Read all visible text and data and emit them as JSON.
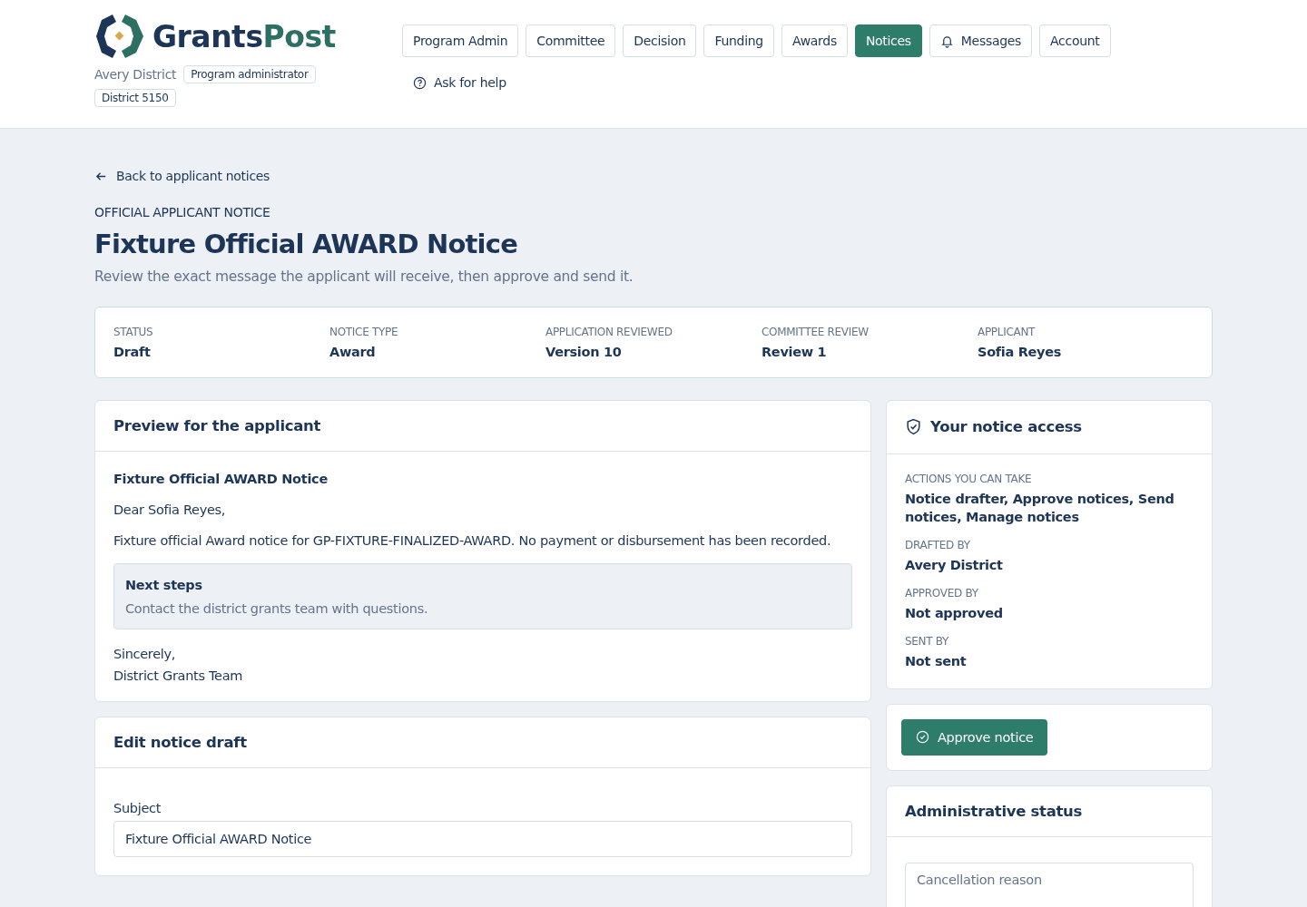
{
  "brand": {
    "first": "Grants",
    "second": "Post"
  },
  "user": {
    "name": "Avery District",
    "role": "Program administrator",
    "district": "District 5150"
  },
  "nav": [
    {
      "label": "Program Admin",
      "selected": false
    },
    {
      "label": "Committee",
      "selected": false
    },
    {
      "label": "Decision",
      "selected": false
    },
    {
      "label": "Funding",
      "selected": false
    },
    {
      "label": "Awards",
      "selected": false
    },
    {
      "label": "Notices",
      "selected": true
    },
    {
      "label": "Messages",
      "selected": false,
      "kind": "bell"
    },
    {
      "label": "Account",
      "selected": false
    }
  ],
  "help": "Ask for help",
  "back": "Back to applicant notices",
  "eyebrow": "OFFICIAL APPLICANT NOTICE",
  "title": "Fixture Official AWARD Notice",
  "subtitle": "Review the exact message the applicant will receive, then approve and send it.",
  "summary": [
    {
      "label": "STATUS",
      "value": "Draft"
    },
    {
      "label": "NOTICE TYPE",
      "value": "Award"
    },
    {
      "label": "APPLICATION REVIEWED",
      "value": "Version 10"
    },
    {
      "label": "COMMITTEE REVIEW",
      "value": "Review 1"
    },
    {
      "label": "APPLICANT",
      "value": "Sofia Reyes"
    }
  ],
  "preview": {
    "heading": "Preview for the applicant",
    "subject": "Fixture Official AWARD Notice",
    "greeting": "Dear Sofia Reyes,",
    "body": "Fixture official Award notice for GP-FIXTURE-FINALIZED-AWARD. No payment or disbursement has been recorded.",
    "next_title": "Next steps",
    "next_text": "Contact the district grants team with questions.",
    "closing": "Sincerely,",
    "signature": "District Grants Team"
  },
  "edit": {
    "heading": "Edit notice draft",
    "subject_label": "Subject",
    "subject_value": "Fixture Official AWARD Notice"
  },
  "access": {
    "heading": "Your notice access",
    "items": [
      {
        "label": "ACTIONS YOU CAN TAKE",
        "value": "Notice drafter, Approve notices, Send notices, Manage notices"
      },
      {
        "label": "DRAFTED BY",
        "value": "Avery District"
      },
      {
        "label": "APPROVED BY",
        "value": "Not approved"
      },
      {
        "label": "SENT BY",
        "value": "Not sent"
      }
    ]
  },
  "approve_button": "Approve notice",
  "admin": {
    "heading": "Administrative status",
    "reason_placeholder": "Cancellation reason"
  }
}
